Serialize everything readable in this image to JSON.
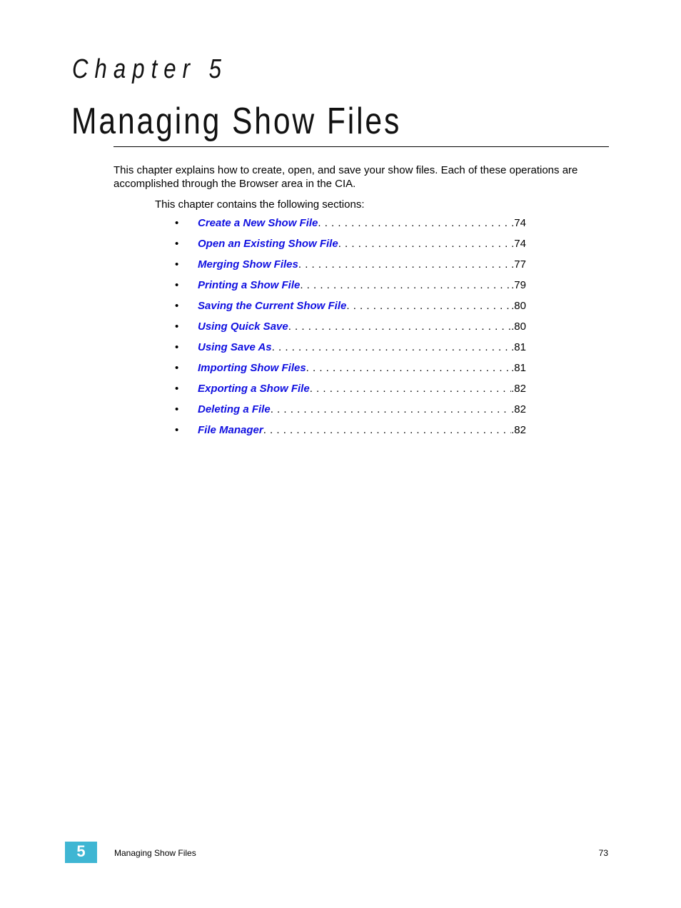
{
  "header": {
    "chapter_label": "Chapter 5",
    "chapter_title": "Managing Show Files"
  },
  "body": {
    "intro": "This chapter explains how to create, open, and save your show files. Each of these operations are accomplished through the Browser area in the CIA.",
    "sections_lead": "This chapter contains the following sections:",
    "bullet_glyph": "•",
    "toc": [
      {
        "title": "Create a New Show File",
        "page": ".74"
      },
      {
        "title": "Open an Existing Show File",
        "page": ".74"
      },
      {
        "title": "Merging Show Files",
        "page": ".77"
      },
      {
        "title": "Printing a Show File",
        "page": ".79"
      },
      {
        "title": "Saving the Current Show File",
        "page": ".80"
      },
      {
        "title": "Using Quick Save",
        "page": ".80"
      },
      {
        "title": "Using Save As",
        "page": ".81"
      },
      {
        "title": "Importing Show Files",
        "page": ".81"
      },
      {
        "title": "Exporting a Show File",
        "page": ".82"
      },
      {
        "title": "Deleting a File",
        "page": ".82"
      },
      {
        "title": "File Manager",
        "page": ".82"
      }
    ]
  },
  "footer": {
    "chapter_tab": "5",
    "chapter_title": "Managing Show Files",
    "page_number": "73",
    "tab_color": "#3fb6d3"
  },
  "colors": {
    "link": "#1010e0",
    "text": "#000000"
  }
}
